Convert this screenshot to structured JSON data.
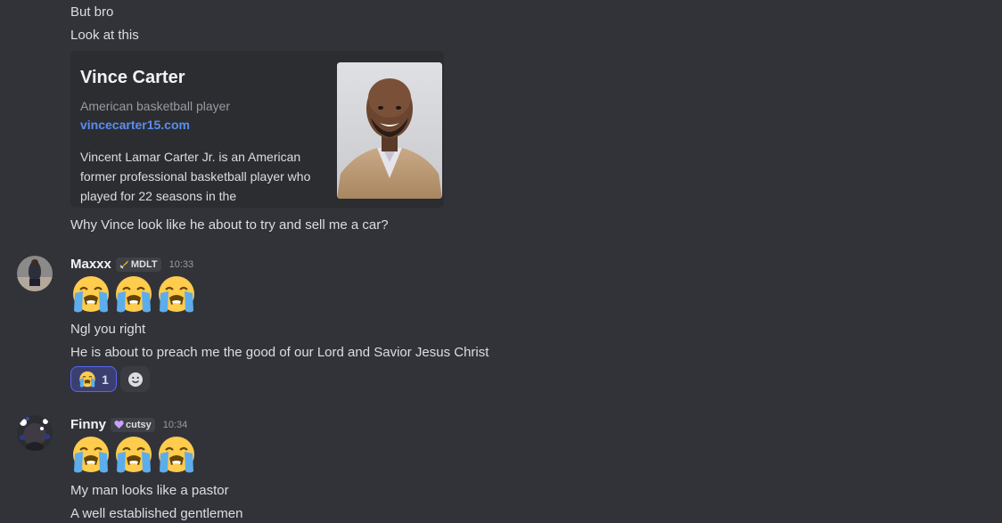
{
  "messages_top": {
    "line1": "But bro",
    "line2": "Look at this",
    "line3": "Why Vince look like he about to try and sell me a car?"
  },
  "embed": {
    "title": "Vince Carter",
    "subtitle": "American basketball player",
    "link": "vincecarter15.com",
    "description": "Vincent Lamar Carter Jr. is an American former professional basketball player who played for 22 seasons in the",
    "thumbnail_icon": "person-photo"
  },
  "message_maxxx": {
    "username": "Maxxx",
    "tag": "MDLT",
    "tag_icon": "sword-icon",
    "time": "10:33",
    "emoji": "loudly-crying-face",
    "line1": "Ngl you right",
    "line2": "He is about to preach  me the good of our Lord and Savior Jesus Christ",
    "reaction_count": "1"
  },
  "message_finny": {
    "username": "Finny",
    "tag": "cutsy",
    "tag_icon": "heart-icon",
    "time": "10:34",
    "emoji": "loudly-crying-face",
    "line1": "My man looks like a pastor",
    "line2": "A well established gentlemen"
  },
  "colors": {
    "background": "#323339",
    "embed_bg": "#2b2d31",
    "link": "#5b8def",
    "reaction_bg": "#3b3f70",
    "reaction_border": "#5865f2"
  }
}
